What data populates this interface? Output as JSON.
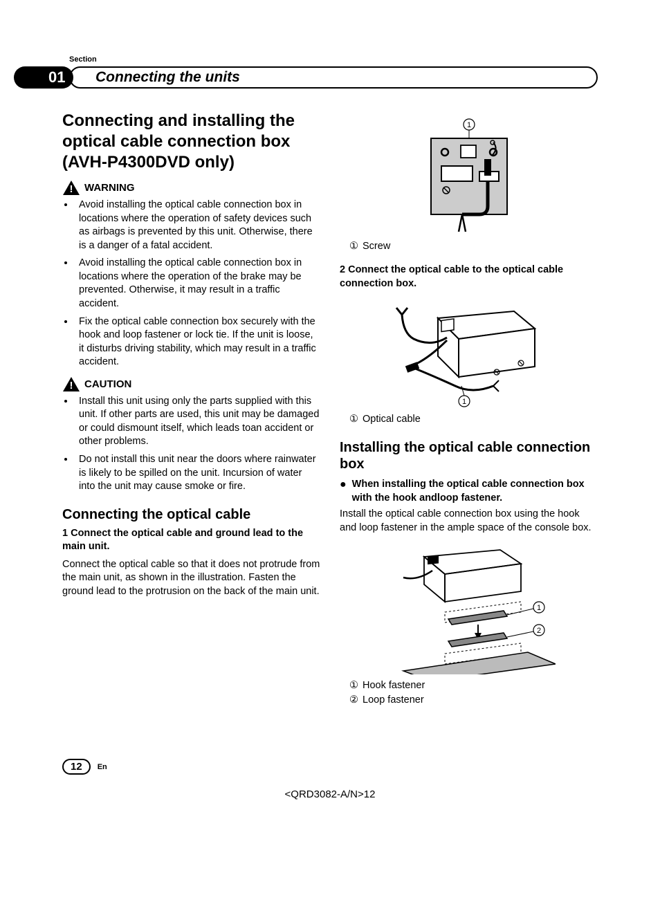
{
  "section_label": "Section",
  "header": {
    "number": "01",
    "title": "Connecting the units"
  },
  "left": {
    "h1": "Connecting and installing the optical cable connection box (AVH-P4300DVD only)",
    "warning_label": "WARNING",
    "warning_items": [
      "Avoid installing the optical cable connection box in locations where the operation of safety devices such as airbags is prevented by this unit. Otherwise, there is a danger of a fatal accident.",
      "Avoid installing the optical cable connection box in locations where the operation of the brake may be prevented. Otherwise, it may result in a traffic accident.",
      "Fix the optical cable connection box securely with the hook and loop fastener or lock tie. If the unit is loose, it disturbs driving stability, which may result in a traffic accident."
    ],
    "caution_label": "CAUTION",
    "caution_items": [
      "Install this unit using only the parts supplied with this unit. If other parts are used, this unit may be damaged or could dismount itself, which leads toan accident or other problems.",
      "Do not install this unit near the doors where rainwater is likely to be spilled on the unit. Incursion of water into the unit may cause smoke or fire."
    ],
    "h2": "Connecting the optical cable",
    "step1_label": "1    Connect the optical cable and ground lead to the main unit.",
    "step1_body": "Connect the optical cable so that it does not protrude from the main unit, as shown in the illustration. Fasten the ground lead to the protrusion on the back of the main unit."
  },
  "right": {
    "fig1_callout_1": "Screw",
    "step2_label": "2    Connect the optical cable to the optical cable connection box.",
    "fig2_callout_1": "Optical cable",
    "h2": "Installing the optical cable connection box",
    "subhead": "When installing the optical cable connection box with the hook andloop fastener.",
    "body": "Install the optical cable connection box using the hook and loop fastener in the ample space of the console box.",
    "fig3_callout_1": "Hook fastener",
    "fig3_callout_2": "Loop fastener"
  },
  "footer": {
    "page": "12",
    "lang": "En"
  },
  "doc_code": "<QRD3082-A/N>12"
}
